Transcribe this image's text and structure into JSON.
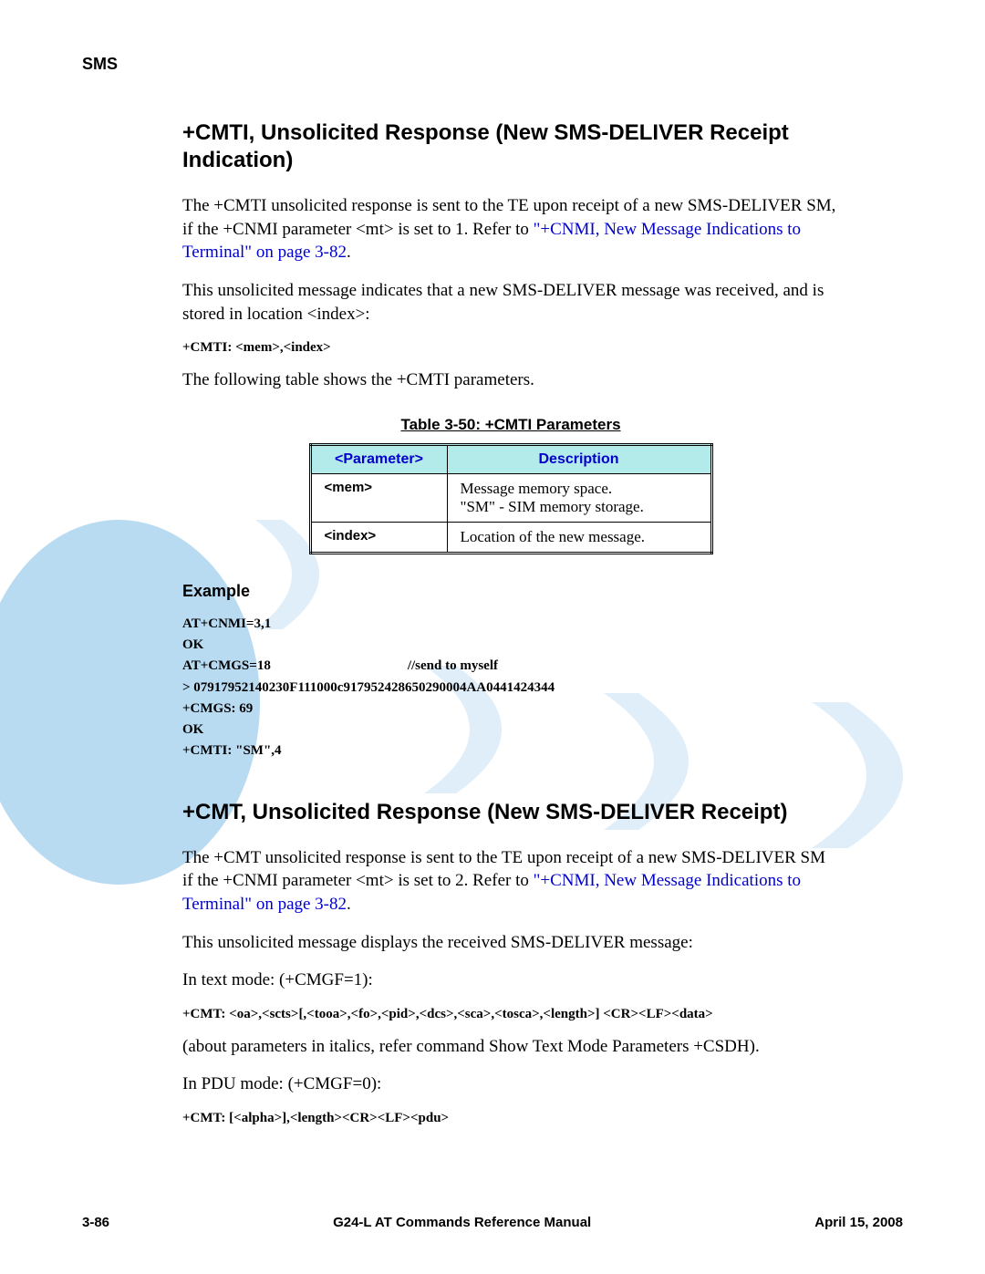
{
  "header": {
    "section": "SMS"
  },
  "section1": {
    "heading": "+CMTI, Unsolicited Response (New SMS-DELIVER Receipt Indication)",
    "p1a": "The +CMTI unsolicited response is sent to the TE upon receipt of a new SMS-DELIVER SM, if the +CNMI parameter <mt> is set to 1. Refer to ",
    "p1_link": "\"+CNMI, New Message Indications to Terminal\" on page 3-82",
    "p1b": ".",
    "p2": "This unsolicited message indicates that a new SMS-DELIVER message was received, and is stored in location <index>:",
    "code": "+CMTI: <mem>,<index>",
    "p3": "The following table shows the +CMTI parameters.",
    "table_caption": "Table 3-50: +CMTI Parameters",
    "th_param": "<Parameter>",
    "th_desc": "Description",
    "rows": [
      {
        "param": "<mem>",
        "desc": "Message memory space.\n\"SM\"  - SIM memory storage."
      },
      {
        "param": "<index>",
        "desc": "Location of the new message."
      }
    ],
    "example_label": "Example",
    "example_text": "AT+CNMI=3,1\nOK\nAT+CMGS=18                                        //send to myself\n> 07917952140230F111000c917952428650290004AA0441424344\n+CMGS: 69\nOK\n+CMTI: \"SM\",4"
  },
  "section2": {
    "heading": "+CMT, Unsolicited Response (New SMS-DELIVER Receipt)",
    "p1a": "The +CMT unsolicited response is sent to the TE upon receipt of a new SMS-DELIVER SM if the +CNMI parameter <mt> is set to 2. Refer to ",
    "p1_link": "\"+CNMI, New Message Indications to Terminal\" on page 3-82",
    "p1b": ".",
    "p2": "This unsolicited message displays the received SMS-DELIVER message:",
    "p3": "In text mode: (+CMGF=1):",
    "code1": " +CMT: <oa>,<scts>[,<tooa>,<fo>,<pid>,<dcs>,<sca>,<tosca>,<length>] <CR><LF><data>",
    "p4": "(about parameters in italics, refer command Show Text Mode Parameters +CSDH).",
    "p5": "In PDU mode: (+CMGF=0):",
    "code2": " +CMT: [<alpha>],<length><CR><LF><pdu>"
  },
  "footer": {
    "left": "3-86",
    "center": "G24-L AT Commands Reference Manual",
    "right": "April 15, 2008"
  }
}
